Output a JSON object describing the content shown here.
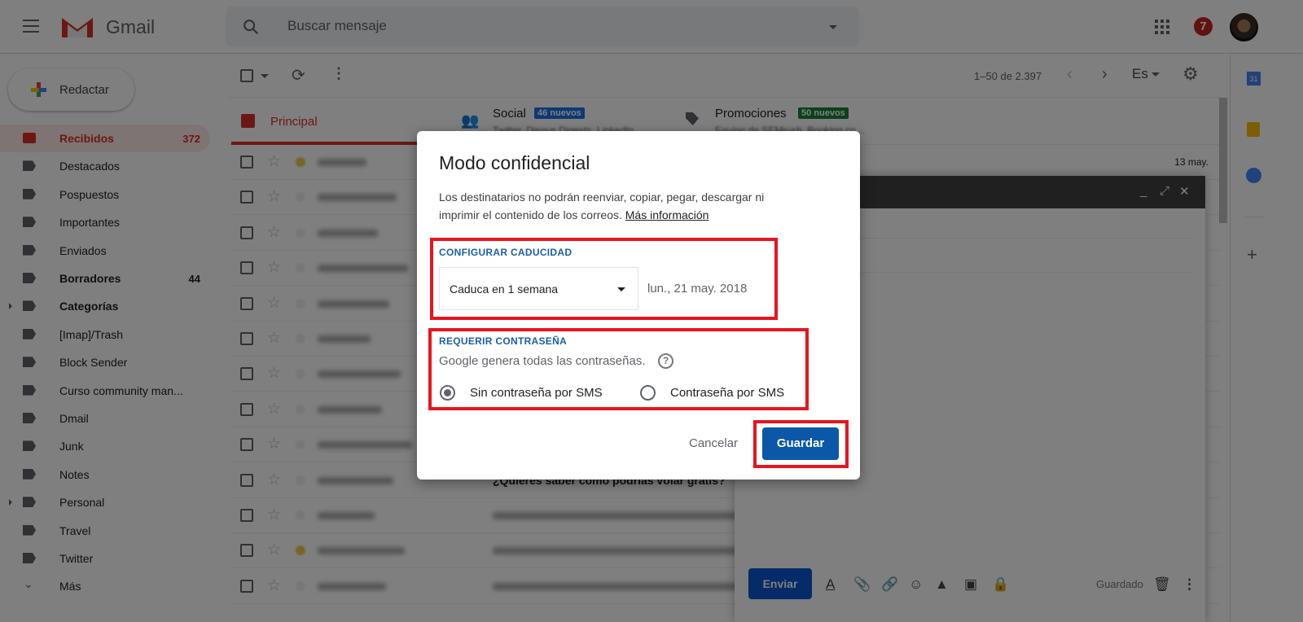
{
  "header": {
    "app_name": "Gmail",
    "search_placeholder": "Buscar mensaje",
    "notifications": "7"
  },
  "sidebar": {
    "compose_label": "Redactar",
    "items": [
      {
        "label": "Recibidos",
        "count": "372",
        "icon": "inbox-icon",
        "active": true
      },
      {
        "label": "Destacados",
        "icon": "star-icon"
      },
      {
        "label": "Pospuestos",
        "icon": "clock-icon"
      },
      {
        "label": "Importantes",
        "icon": "important-icon"
      },
      {
        "label": "Enviados",
        "icon": "send-icon"
      },
      {
        "label": "Borradores",
        "count": "44",
        "icon": "draft-icon",
        "bold": true
      },
      {
        "label": "Categorías",
        "icon": "label-icon",
        "bold": true,
        "expandable": true
      },
      {
        "label": "[Imap]/Trash",
        "icon": "label-icon"
      },
      {
        "label": "Block Sender",
        "icon": "label-icon"
      },
      {
        "label": "Curso community man...",
        "icon": "label-icon"
      },
      {
        "label": "Dmail",
        "icon": "label-icon"
      },
      {
        "label": "Junk",
        "icon": "label-icon"
      },
      {
        "label": "Notes",
        "icon": "label-icon"
      },
      {
        "label": "Personal",
        "icon": "label-icon",
        "expandable": true
      },
      {
        "label": "Travel",
        "icon": "label-icon"
      },
      {
        "label": "Twitter",
        "icon": "label-icon"
      },
      {
        "label": "Más",
        "icon": "chevron-down-icon"
      }
    ]
  },
  "toolbar": {
    "pagination": "1–50 de 2.397",
    "language": "Es"
  },
  "tabs": [
    {
      "label": "Principal",
      "active": true
    },
    {
      "label": "Social",
      "badge": "46 nuevos",
      "badge_color": "#1a73e8",
      "subtitle": "Twitter, Disqus Digests, LinkedIn..."
    },
    {
      "label": "Promociones",
      "badge": "50 nuevos",
      "badge_color": "#188038",
      "subtitle": "Equipo de SEMrush, Booking.co..."
    }
  ],
  "emails": [
    {
      "date": "13 may.",
      "important": true
    },
    {},
    {},
    {},
    {},
    {},
    {},
    {},
    {},
    {
      "subject": "¿Quieres saber cómo podrías volar gratis?"
    },
    {},
    {
      "important": true
    },
    {}
  ],
  "compose": {
    "send_label": "Enviar",
    "status": "Guardado"
  },
  "dialog": {
    "title": "Modo confidencial",
    "description": "Los destinatarios no podrán reenviar, copiar, pegar, descargar ni imprimir el contenido de los correos.",
    "more_info": "Más información",
    "expiry_heading": "CONFIGURAR CADUCIDAD",
    "expiry_selected": "Caduca en 1 semana",
    "expiry_date": "lun., 21 may. 2018",
    "password_heading": "REQUERIR CONTRASEÑA",
    "password_note": "Google genera todas las contraseñas.",
    "options": [
      {
        "label": "Sin contraseña por SMS",
        "selected": true
      },
      {
        "label": "Contraseña por SMS",
        "selected": false
      }
    ],
    "cancel": "Cancelar",
    "save": "Guardar"
  },
  "colors": {
    "accent": "#d93025",
    "primary_button": "#0b57a8",
    "highlight": "#e8141f"
  }
}
